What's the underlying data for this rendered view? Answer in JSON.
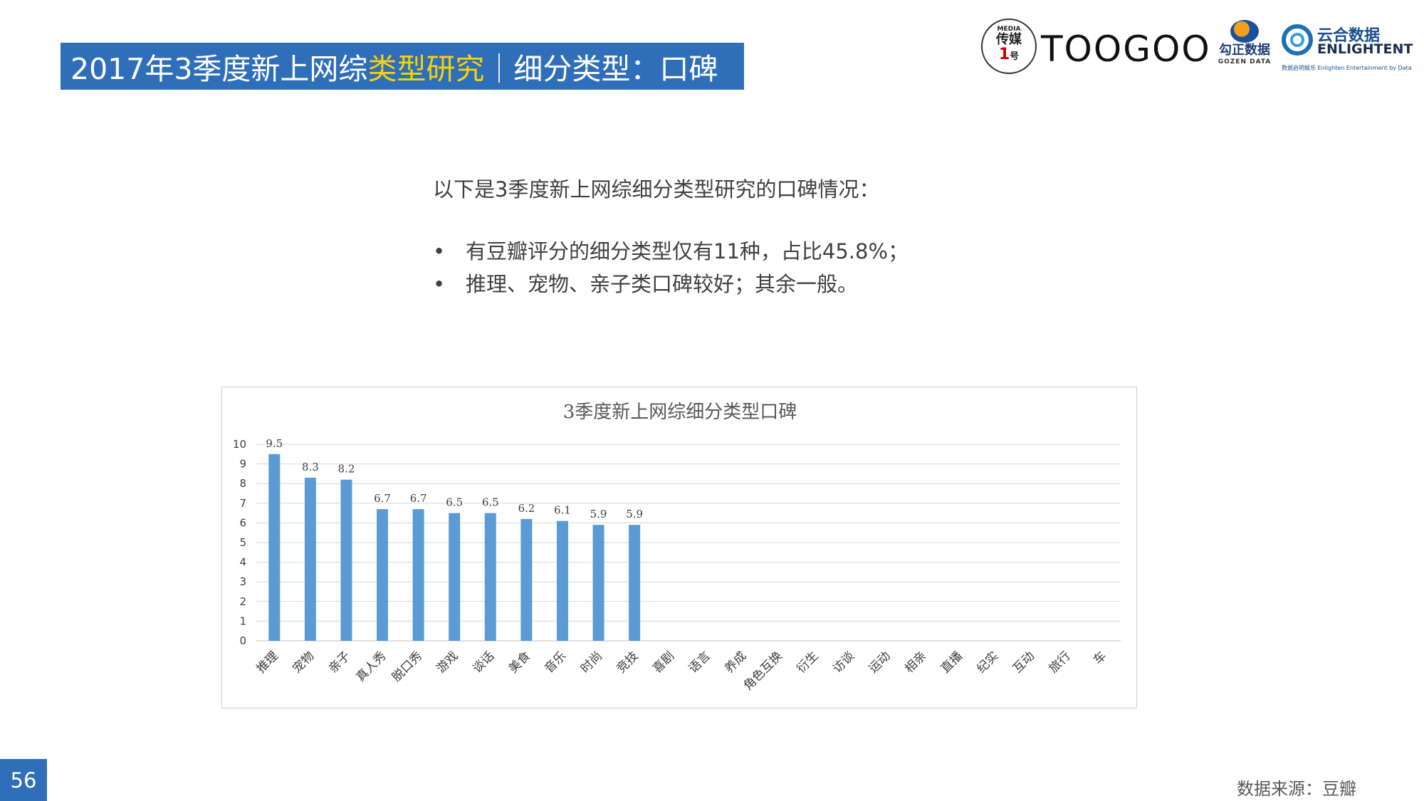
{
  "header": {
    "title_part1": "2017年3季度新上网综",
    "title_highlight": "类型研究",
    "title_part2": "｜细分类型：口碑"
  },
  "logos": {
    "media_tag": "MEDIA",
    "media_main": "传媒",
    "media_num": "1",
    "media_suffix": "号",
    "toogoo": "TOOGOO",
    "gozen_cn": "勾正数据",
    "gozen_en": "GOZEN DATA",
    "enlight_cn": "云合数据",
    "enlight_en": "ENLIGHTENT",
    "enlight_sub": "数据启明娱乐 Enlighten Entertainment by Data"
  },
  "content": {
    "intro": "以下是3季度新上网综细分类型研究的口碑情况：",
    "bullets": [
      "有豆瓣评分的细分类型仅有11种，占比45.8%；",
      "推理、宠物、亲子类口碑较好；其余一般。"
    ],
    "bullet_marker": "•"
  },
  "footer": {
    "page_number": "56",
    "source": "数据来源：豆瓣"
  },
  "colors": {
    "bar": "#5b9bd5",
    "title_bar": "#2f6fba",
    "highlight": "#f5d20a",
    "grid": "#d9d9d9"
  },
  "chart_data": {
    "type": "bar",
    "title": "3季度新上网综细分类型口碑",
    "categories": [
      "推理",
      "宠物",
      "亲子",
      "真人秀",
      "脱口秀",
      "游戏",
      "谈话",
      "美食",
      "音乐",
      "时尚",
      "竞技",
      "喜剧",
      "语言",
      "养成",
      "角色互换",
      "衍生",
      "访谈",
      "运动",
      "相亲",
      "直播",
      "纪实",
      "互动",
      "旅行",
      "车"
    ],
    "values": [
      9.5,
      8.3,
      8.2,
      6.7,
      6.7,
      6.5,
      6.5,
      6.2,
      6.1,
      5.9,
      5.9,
      null,
      null,
      null,
      null,
      null,
      null,
      null,
      null,
      null,
      null,
      null,
      null,
      null
    ],
    "data_labels": [
      "9.5",
      "8.3",
      "8.2",
      "6.7",
      "6.7",
      "6.5",
      "6.5",
      "6.2",
      "6.1",
      "5.9",
      "5.9"
    ],
    "yticks": [
      0,
      1,
      2,
      3,
      4,
      5,
      6,
      7,
      8,
      9,
      10
    ],
    "ylim": [
      0,
      10
    ],
    "grid": true,
    "legend": "none",
    "xlabel": "",
    "ylabel": ""
  }
}
